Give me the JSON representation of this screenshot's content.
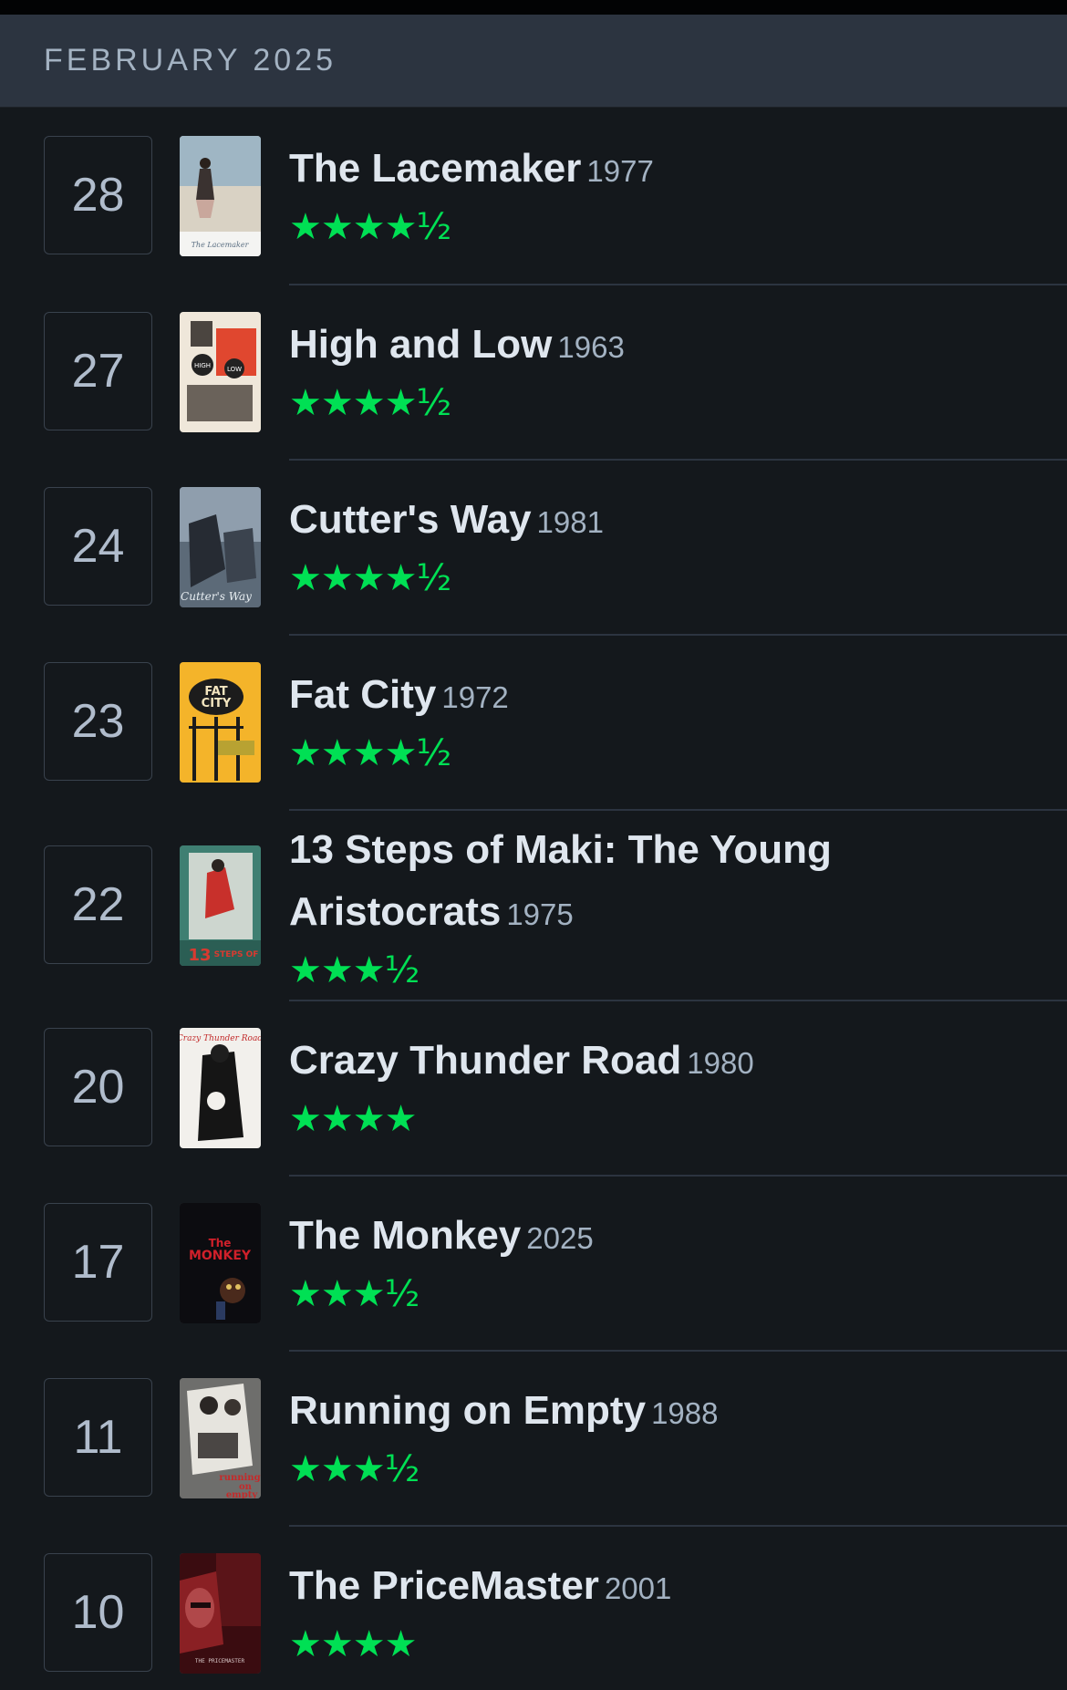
{
  "header": {
    "month": "FEBRUARY 2025"
  },
  "entries": [
    {
      "day": "28",
      "title": "The Lacemaker",
      "year": "1977",
      "rating": "★★★★½",
      "stars": 4.5,
      "poster_icon": "lacemaker-poster"
    },
    {
      "day": "27",
      "title": "High and Low",
      "year": "1963",
      "rating": "★★★★½",
      "stars": 4.5,
      "poster_icon": "high-and-low-poster"
    },
    {
      "day": "24",
      "title": "Cutter's Way",
      "year": "1981",
      "rating": "★★★★½",
      "stars": 4.5,
      "poster_icon": "cutters-way-poster"
    },
    {
      "day": "23",
      "title": "Fat City",
      "year": "1972",
      "rating": "★★★★½",
      "stars": 4.5,
      "poster_icon": "fat-city-poster"
    },
    {
      "day": "22",
      "title": "13 Steps of Maki: The Young Aristocrats",
      "year": "1975",
      "rating": "★★★½",
      "stars": 3.5,
      "poster_icon": "13-steps-of-maki-poster"
    },
    {
      "day": "20",
      "title": "Crazy Thunder Road",
      "year": "1980",
      "rating": "★★★★",
      "stars": 4,
      "poster_icon": "crazy-thunder-road-poster"
    },
    {
      "day": "17",
      "title": "The Monkey",
      "year": "2025",
      "rating": "★★★½",
      "stars": 3.5,
      "poster_icon": "the-monkey-poster"
    },
    {
      "day": "11",
      "title": "Running on Empty",
      "year": "1988",
      "rating": "★★★½",
      "stars": 3.5,
      "poster_icon": "running-on-empty-poster"
    },
    {
      "day": "10",
      "title": "The PriceMaster",
      "year": "2001",
      "rating": "★★★★",
      "stars": 4,
      "poster_icon": "the-pricemaster-poster"
    }
  ],
  "colors": {
    "background": "#14181c",
    "header": "#2c3440",
    "star": "#00e054"
  }
}
